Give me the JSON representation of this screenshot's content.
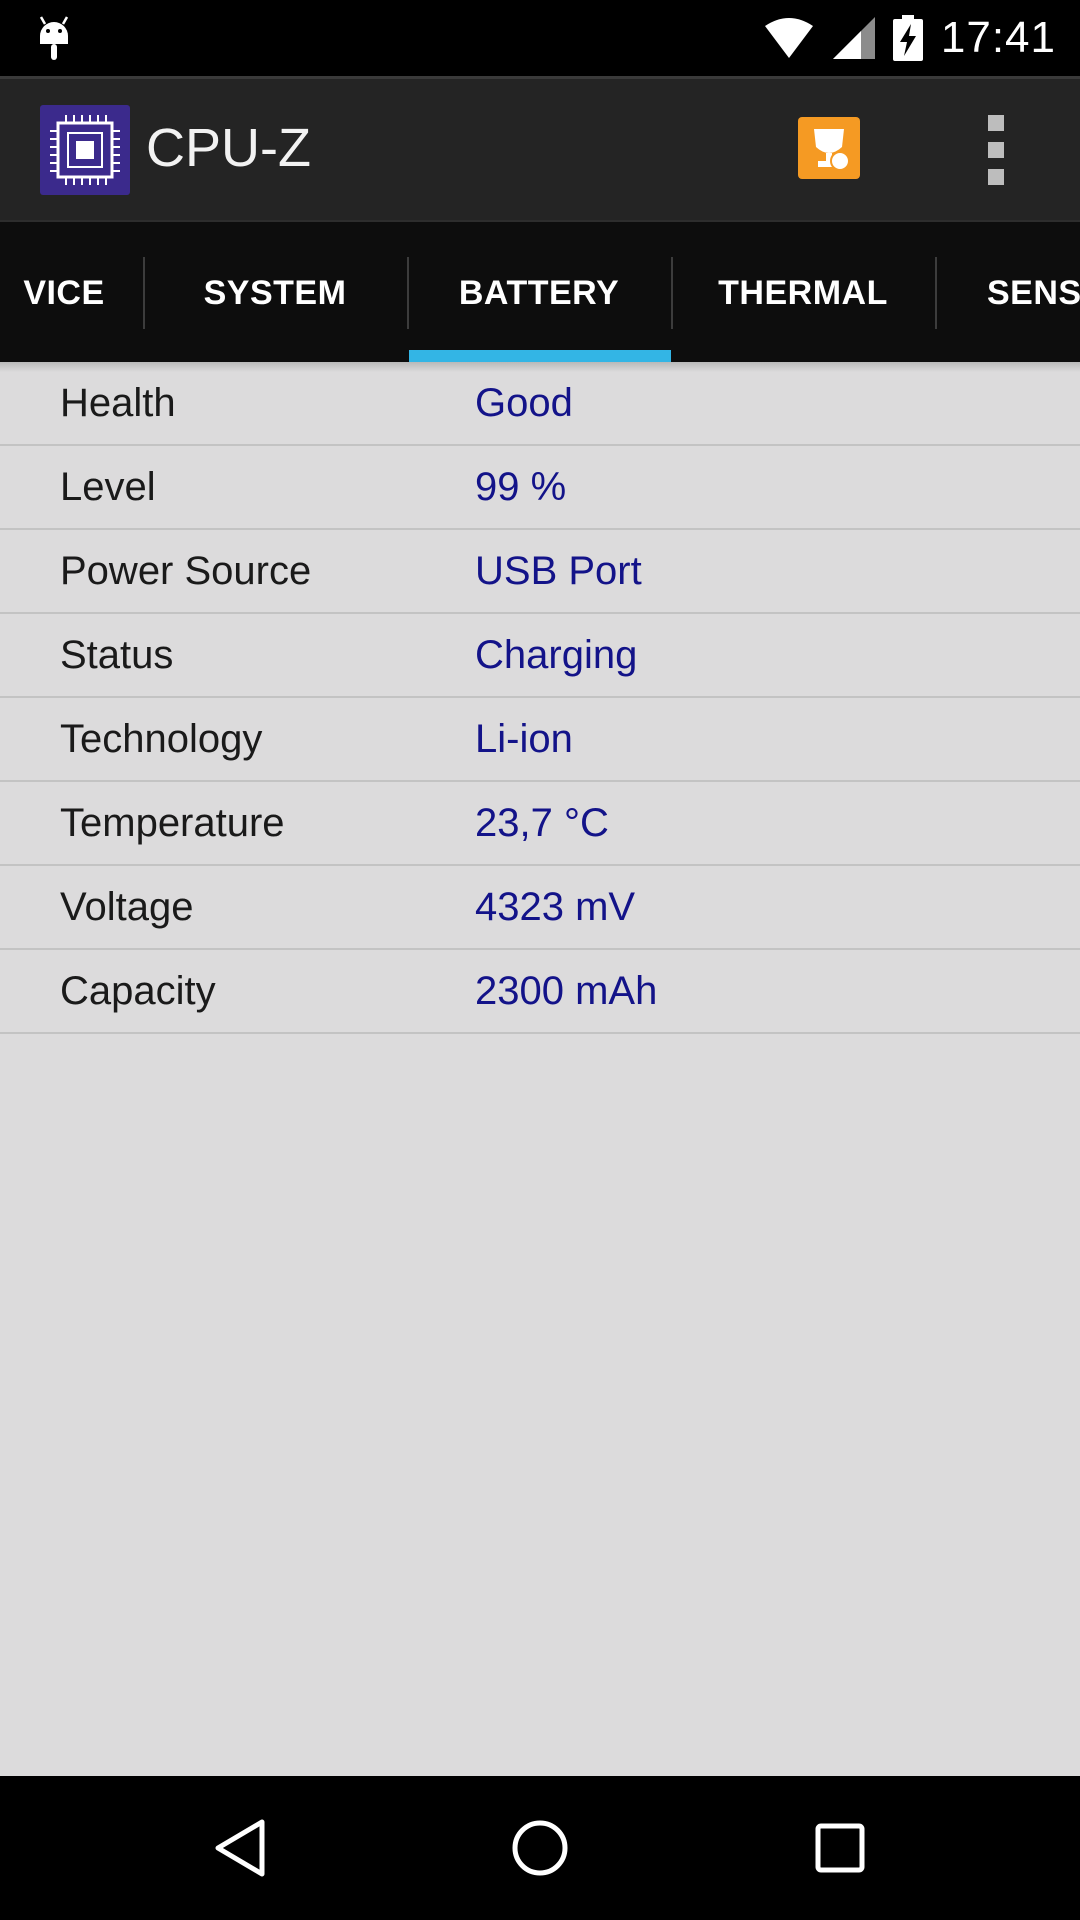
{
  "status_bar": {
    "time": "17:41",
    "icons": [
      "android-icon",
      "wifi-icon",
      "signal-icon",
      "battery-charging-icon"
    ]
  },
  "app_bar": {
    "title": "CPU-Z",
    "logo_icon": "cpu-chip-icon",
    "actions": [
      "trophy-icon",
      "overflow-menu-icon"
    ]
  },
  "tabs": [
    {
      "label": "VICE",
      "selected": false
    },
    {
      "label": "SYSTEM",
      "selected": false
    },
    {
      "label": "BATTERY",
      "selected": true
    },
    {
      "label": "THERMAL",
      "selected": false
    },
    {
      "label": "SENSO",
      "selected": false
    }
  ],
  "battery": [
    {
      "label": "Health",
      "value": "Good"
    },
    {
      "label": "Level",
      "value": "99 %"
    },
    {
      "label": "Power Source",
      "value": "USB Port"
    },
    {
      "label": "Status",
      "value": "Charging"
    },
    {
      "label": "Technology",
      "value": "Li-ion"
    },
    {
      "label": "Temperature",
      "value": "23,7 °C"
    },
    {
      "label": "Voltage",
      "value": "4323 mV"
    },
    {
      "label": "Capacity",
      "value": "2300 mAh"
    }
  ],
  "nav_bar": [
    "back-icon",
    "home-icon",
    "recents-icon"
  ],
  "colors": {
    "accent": "#33b5e5",
    "value_text": "#131389",
    "content_bg": "#dcdbdc",
    "app_bar": "#242424"
  }
}
